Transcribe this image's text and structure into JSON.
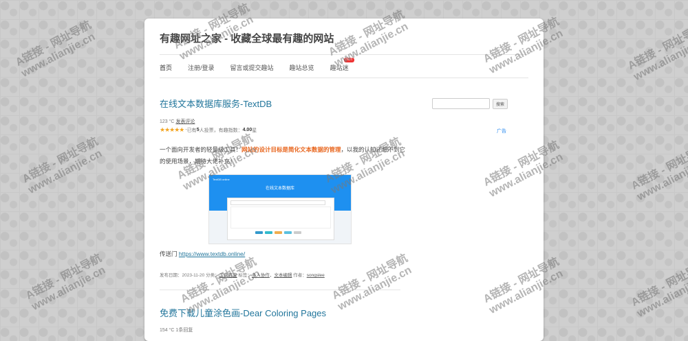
{
  "site": {
    "title": "有趣网址之家 - 收藏全球最有趣的网站"
  },
  "nav": {
    "items": [
      {
        "label": "首页"
      },
      {
        "label": "注册/登录"
      },
      {
        "label": "留言或提交趣站"
      },
      {
        "label": "趣站总览"
      },
      {
        "label": "趣站迷",
        "badge": "HOT"
      }
    ]
  },
  "search": {
    "value": "",
    "button_label": "搜索"
  },
  "ad": {
    "label": "广告"
  },
  "post1": {
    "title": "在线文本数据库服务-TextDB",
    "temp": "123 °C",
    "comment_link": "发表评论",
    "stars": "★★★★★",
    "rating_prefix": "已有",
    "rating_count": "5",
    "rating_mid": "人投票，有趣指数：",
    "rating_value": "4.00",
    "rating_suffix": "星",
    "excerpt_pre": "一个面向开发者的轻量级工具！",
    "excerpt_highlight": "网站的设计目标是简化文本数据的管理",
    "excerpt_post": "，以我的认知还想不到它的使用场景，期待大佬补充！",
    "screenshot_brand": "TextDB online",
    "screenshot_title": "在线文本数据库",
    "link_prefix": "传送门",
    "link_url": "https://www.textdb.online/",
    "meta_date_label": "发布日期：",
    "meta_date": "2023-11-20",
    "meta_cat_label": "分类：",
    "meta_cat": "工具百宝",
    "meta_tag_label": "标签：",
    "meta_tag1": "多人协作",
    "meta_tag2": "文本编辑",
    "meta_author_label": "作者：",
    "meta_author": "songslee"
  },
  "post2": {
    "title": "免费下载儿童涂色画-Dear Coloring Pages",
    "meta": "154 °C 1条回复"
  },
  "watermark": {
    "line1": "A链接 - 网址导航",
    "line2": "www.alianjie.cn"
  },
  "colors": {
    "link": "#21759b",
    "highlight": "#e8661e",
    "star": "#f3a521",
    "hot": "#e33333"
  }
}
